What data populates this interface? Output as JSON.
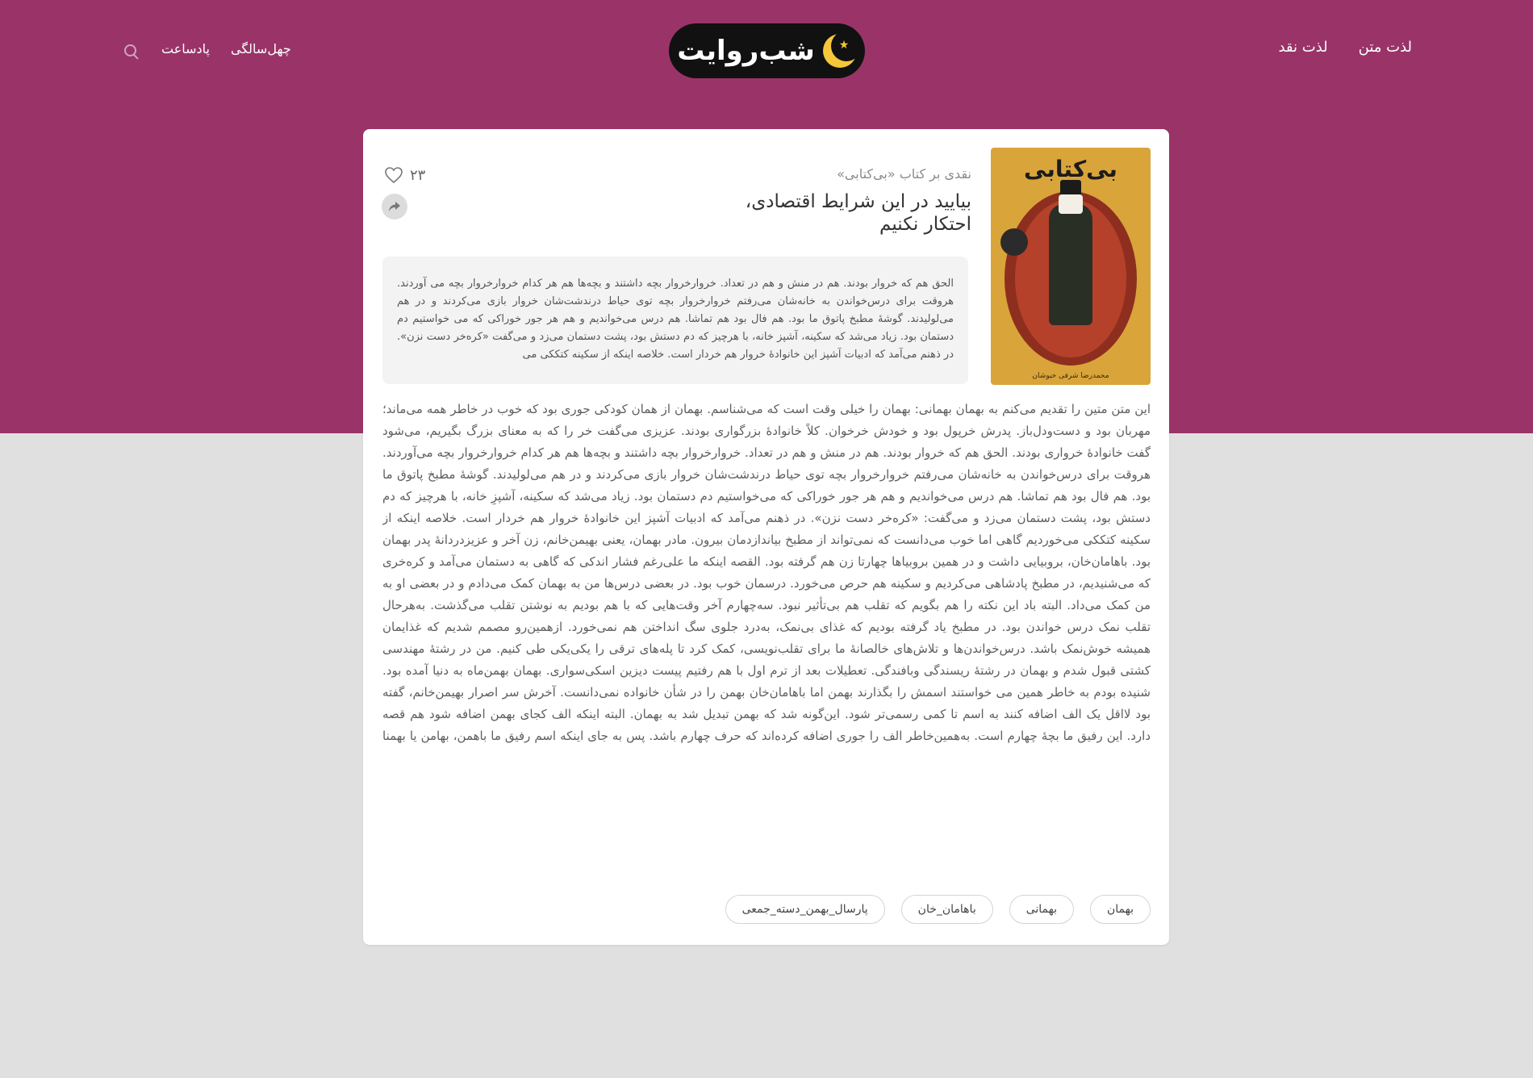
{
  "header": {
    "nav_right": [
      "لذت متن",
      "لذت نقد"
    ],
    "nav_left": [
      "چهل‌سالگی",
      "پادساعت"
    ],
    "logo_text": "شب‌روایت",
    "search_icon": "search-icon",
    "brand_color": "#9a3468"
  },
  "article": {
    "cover_title": "بی‌کتابی",
    "cover_author": "محمدرضا شرفی خبوشان",
    "kicker": "نقدی بر کتاب «بی‌کتابی»",
    "headline": "بیایید در این شرایط اقتصادی، احتکار نکنیم",
    "like_count": "۲۳",
    "like_icon": "heart-icon",
    "share_icon": "share-icon",
    "excerpt": "الحق هم که خروار بودند. هم در منش و هم در تعداد. خروارخروار بچه داشتند و بچه‌ها هم هر کدام خروارخروار بچه می آوردند. هروقت برای درس‌خواندن به خانه‌شان می‌رفتم خروارخروار بچه توی حیاط درندشت‌شان خروار بازی می‌کردند و در هم می‌لولیدند. گوشهٔ مطبخ پاتوق ما بود. هم فال بود هم تماشا. هم درس می‌خواندیم و هم هر جور خوراکی که می خواستیم دم دستمان بود. زیاد می‌شد که سکینه، آشپز خانه، با هرچیز که دم دستش بود، پشت دستمان می‌زد و می‌گفت «کره‌خر دست نزن». در ذهنم می‌آمد که ادبیات آشپز این خانوادهٔ خروار هم خردار است. خلاصه اینکه از سکینه کتککی می",
    "body": "این متن متین را تقدیم می‌کنم به بهمان بهمانی: بهمان را خیلی وقت است که می‌شناسم. بهمان از همان کودکی جوری بود که خوب در خاطر همه می‌ماند؛ مهربان بود و دست‌ودل‌باز. پدرش خرپول بود و خودش خرخوان. کلاً خانوادهٔ بزرگواری بودند. عزیزی می‌گفت خر را که به معنای بزرگ بگیریم، می‌شود گفت خانوادهٔ خرواری بودند. الحق هم که خروار بودند. هم در منش و هم در تعداد. خروارخروار بچه داشتند و بچه‌ها هم هر کدام خروارخروار بچه می‌آوردند. هروقت برای درس‌خواندن به خانه‌شان می‌رفتم خروارخروار بچه توی حیاط درندشت‌شان خروار بازی می‌کردند و در هم می‌لولیدند. گوشهٔ مطبخ پاتوق ما بود. هم فال بود هم تماشا. هم درس می‌خواندیم و هم هر جور خوراکی که می‌خواستیم دم دستمان بود. زیاد می‌شد که سکینه، آشپزِ خانه، با هرچیز که دم دستش بود، پشت دستمان می‌زد و می‌گفت: «کره‌خر دست نزن». در ذهنم می‌آمد که ادبیات آشپز این خانوادهٔ خروار هم خردار است. خلاصه اینکه از سکینه کتککی می‌خوردیم گاهی اما خوب می‌دانست که نمی‌تواند از مطبخ بیاندازدمان بیرون. مادر بهمان، یعنی بهیمن‌خانم، زن آخر و عزیزدردانهٔ پدر بهمان بود. باهامان‌خان، بروبیایی داشت و در همین بروبیاها چهارتا زن هم گرفته بود. القصه اینکه ما علی‌رغم فشار اندکی که گاهی به دستمان می‌آمد و کره‌خری که می‌شنیدیم، در مطبخ پادشاهی می‌کردیم و سکینه هم حرص می‌خورد. درسمان خوب بود. در بعضی درس‌ها من به بهمان کمک می‌دادم و در بعضی او به من کمک می‌داد. البته باد این نکته را هم بگویم که تقلب هم بی‌تأثیر نبود. سه‌چهارم آخر وقت‌هایی که با هم بودیم به نوشتن تقلب می‌گذشت. به‌هرحال تقلب نمک درس خواندن بود. در مطبخ یاد گرفته بودیم که غذای بی‌نمک، به‌درد جلوی سگ انداختن هم نمی‌خورد. ازهمین‌رو مصمم شدیم که غذایمان همیشه خوش‌نمک باشد. درس‌خواندن‌ها و تلاش‌های خالصانهٔ ما برای تقلب‌نویسی، کمک کرد تا پله‌های ترقی را یکی‌یکی طی کنیم. من در رشتهٔ مهندسی کشتی قبول شدم و بهمان در رشتهٔ ریسندگی وبافندگی. تعطیلات بعد از ترم اول با هم رفتیم پیست دیزین اسکی‌سواری. بهمان بهمن‌ماه به دنیا آمده بود. شنیده بودم به خاطر همین می خواستند اسمش را بگذارند بهمن اما باهامان‌خان بهمن را در شأن خانواده نمی‌دانست. آخرش سر اصرار بهیمن‌خانم، گفته بود لااقل یک الف اضافه کنند به اسم تا کمی رسمی‌تر شود. این‌گونه شد که بهمن تبدیل شد به بهمان. البته اینکه الف کجای بهمن اضافه شود هم قصه دارد. این رفیق ما بچهٔ چهارم است. به‌همین‌خاطر الف را جوری اضافه کرده‌اند که حرف چهارم باشد. پس به جای اینکه اسم رفیق ما باهمن، بهامن یا بهمنا بشود، شد بهمان. البته یک روایت دیگر هم هست که وقتی بهمان رفته بود مستراح، از زبان سکینه که داشت برای شمسی تعریف می‌کرد شنیدم. گویا غروب صبحی که بهمان به دنیا آمده بود، چهارصد رأس گوسفند باهامان‌خان زیر بهمن تلف می‌شوند. مادرِ زن اول باهامان‌خان خیلی ناراحت می‌شود و می‌گوید این از قدم نحس فرزند جدید است و او مثل بهمن رو زندگی ما خراب شده و باید اسمش را بهمن بگذارید تا هیچ‌وقت قدم نحسش را فراموش نکنیم. این متن را تقدیم می‌کنم به دوست عزیزم بهمان. باشد تا هیچ‌وقت نحسی‌اش را فراموش نکنیم.",
    "tags": [
      "بهمان",
      "بهمانی",
      "باهامان_خان",
      "پارسال_بهمن_دسته_جمعی"
    ]
  }
}
